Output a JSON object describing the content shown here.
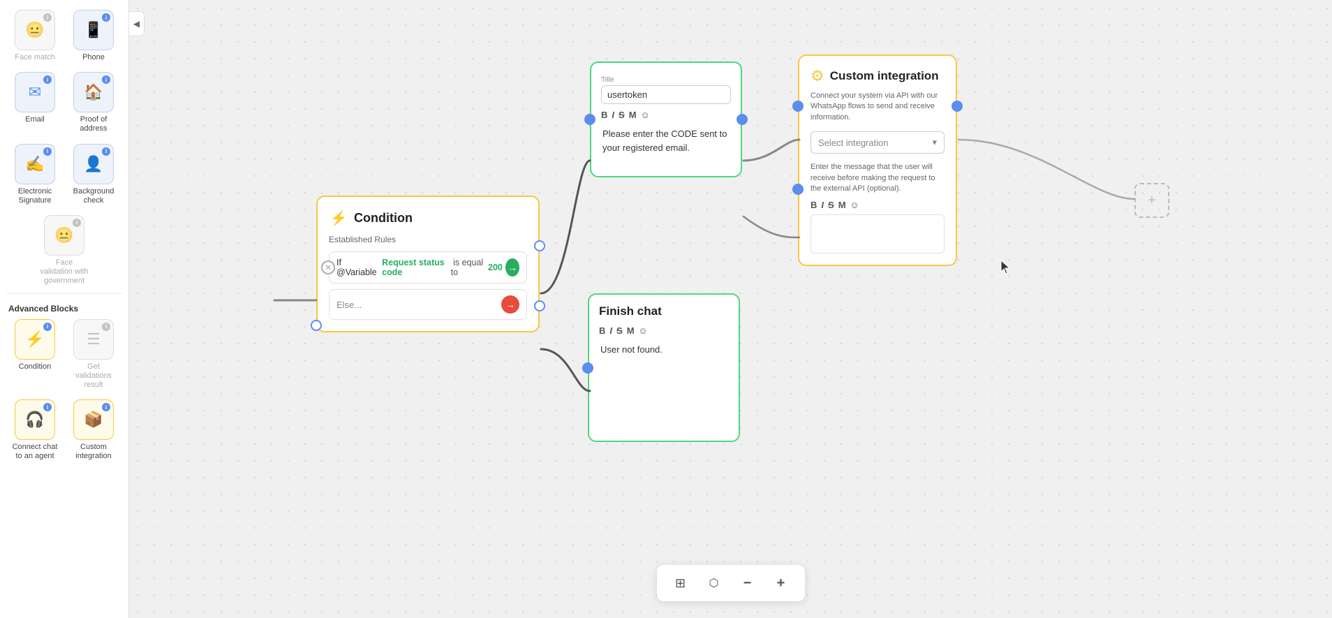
{
  "sidebar": {
    "collapse_icon": "◀",
    "sections": [
      {
        "rows": [
          {
            "items": [
              {
                "id": "face-match",
                "label": "Face match",
                "icon": "😐",
                "color": "gray",
                "dot": "gray"
              },
              {
                "id": "phone",
                "label": "Phone",
                "icon": "📱",
                "color": "blue",
                "dot": "blue"
              }
            ]
          },
          {
            "items": [
              {
                "id": "email",
                "label": "Email",
                "icon": "✉",
                "color": "blue",
                "dot": "blue"
              },
              {
                "id": "proof-of-address",
                "label": "Proof of address",
                "icon": "🏠",
                "color": "blue",
                "dot": "blue"
              }
            ]
          },
          {
            "items": [
              {
                "id": "electronic-signature",
                "label": "Electronic Signature",
                "icon": "✍",
                "color": "blue",
                "dot": "blue"
              },
              {
                "id": "background-check",
                "label": "Background check",
                "icon": "👤",
                "color": "blue",
                "dot": "blue"
              }
            ]
          },
          {
            "items": [
              {
                "id": "face-validation",
                "label": "Face validation with government",
                "icon": "😐",
                "color": "gray",
                "dot": "gray"
              }
            ]
          }
        ]
      }
    ],
    "advanced_label": "Advanced Blocks",
    "advanced_rows": [
      {
        "items": [
          {
            "id": "condition",
            "label": "Condition",
            "icon": "⚡",
            "color": "yellow",
            "dot": "blue"
          },
          {
            "id": "get-validations",
            "label": "Get validations result",
            "icon": "☰",
            "color": "gray",
            "dot": "gray"
          }
        ]
      },
      {
        "items": [
          {
            "id": "connect-chat",
            "label": "Connect chat to an agent",
            "icon": "🎧",
            "color": "yellow",
            "dot": "blue"
          },
          {
            "id": "custom-integration",
            "label": "Custom integration",
            "icon": "📦",
            "color": "yellow",
            "dot": "blue"
          }
        ]
      }
    ]
  },
  "canvas": {
    "condition_node": {
      "title": "Condition",
      "icon": "⚡",
      "subtitle": "Established Rules",
      "rule": {
        "variable_prefix": "If @Variable",
        "variable_name": "Request status code",
        "condition": "is equal to",
        "value": "200"
      },
      "else_label": "Else..."
    },
    "message_node": {
      "field_label": "Title",
      "title_value": "usertoken",
      "toolbar": [
        "B",
        "I",
        "S",
        "M",
        "☺"
      ],
      "content": "Please enter the CODE sent to your registered email."
    },
    "finish_node": {
      "title": "Finish chat",
      "toolbar": [
        "B",
        "I",
        "S",
        "M",
        "☺"
      ],
      "content": "User not found."
    },
    "custom_node": {
      "icon": "⚙",
      "title": "Custom integration",
      "description": "Connect your system via API with our WhatsApp flows to send and receive information.",
      "select_placeholder": "Select integration",
      "optional_message": "Enter the message that the user will receive before making the request to the external API (optional).",
      "toolbar": [
        "B",
        "I",
        "S",
        "M",
        "☺"
      ]
    },
    "placeholder_node": {
      "icon": "+"
    }
  },
  "toolbar": {
    "fit_icon": "⊞",
    "network_icon": "⬡",
    "zoom_out_icon": "−",
    "zoom_in_icon": "+"
  }
}
